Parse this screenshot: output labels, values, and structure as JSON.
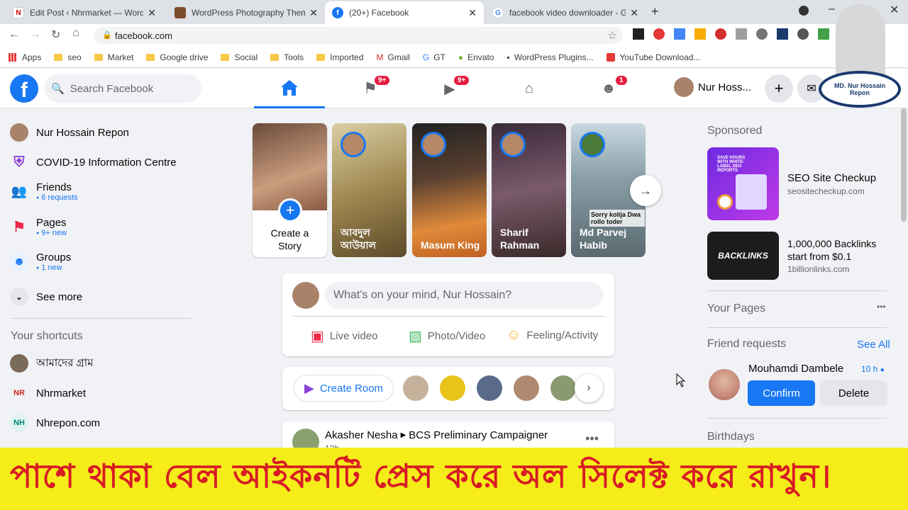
{
  "browser": {
    "tabs": [
      {
        "title": "Edit Post ‹ Nhrmarket — WordPr",
        "active": false
      },
      {
        "title": "WordPress Photography Themes",
        "active": false
      },
      {
        "title": "(20+) Facebook",
        "active": true
      },
      {
        "title": "facebook video downloader - Go",
        "active": false
      }
    ],
    "url": "facebook.com",
    "bookmarks": [
      "Apps",
      "seo",
      "Market",
      "Google drive",
      "Social",
      "Tools",
      "Imported",
      "Gmail",
      "GT",
      "Envato",
      "WordPress Plugins...",
      "YouTube Download..."
    ]
  },
  "fb": {
    "search_placeholder": "Search Facebook",
    "badges": {
      "pages": "9+",
      "watch": "9+",
      "groups": "1"
    },
    "profile_short": "Nur Hoss...",
    "overlay_text": "MD. Nur Hossain Repon"
  },
  "left": {
    "items": [
      {
        "label": "Nur Hossain Repon",
        "sub": ""
      },
      {
        "label": "COVID-19 Information Centre",
        "sub": ""
      },
      {
        "label": "Friends",
        "sub": "6 requests"
      },
      {
        "label": "Pages",
        "sub": "9+ new"
      },
      {
        "label": "Groups",
        "sub": "1 new"
      },
      {
        "label": "See more",
        "sub": ""
      }
    ],
    "shortcuts_title": "Your shortcuts",
    "shortcuts": [
      "আমাদের গ্রাম",
      "Nhrmarket",
      "Nhrepon.com"
    ]
  },
  "stories": [
    {
      "name": "Create a\nStory",
      "line1": "Create a",
      "line2": "Story"
    },
    {
      "line1": "আবদুল",
      "line2": "আউয়াল"
    },
    {
      "line1": "Masum King",
      "line2": ""
    },
    {
      "line1": "Sharif",
      "line2": "Rahman"
    },
    {
      "line1": "Md Parvej",
      "line2": "Habib"
    }
  ],
  "story_caption": "Sorry kolija  Dwa rollo toder",
  "composer": {
    "placeholder": "What's on your mind, Nur Hossain?",
    "live": "Live video",
    "photo": "Photo/Video",
    "feeling": "Feeling/Activity"
  },
  "rooms": {
    "create": "Create Room"
  },
  "post": {
    "author": "Akasher Nesha",
    "target": "BCS Preliminary Campaigner",
    "time": "13h"
  },
  "right": {
    "sponsored": "Sponsored",
    "ads": [
      {
        "title": "SEO Site Checkup",
        "url": "seositecheckup.com",
        "img_text": "SAVE HOURS WITH WHITE-LABEL SEO REPORTS"
      },
      {
        "title": "1,000,000 Backlinks start from $0.1",
        "url": "1billionlinks.com",
        "img_text": "BACKLINKS"
      }
    ],
    "your_pages": "Your Pages",
    "friend_requests": "Friend requests",
    "see_all": "See All",
    "requester": "Mouhamdi Dambele",
    "req_time": "10 h",
    "confirm": "Confirm",
    "delete": "Delete",
    "birthdays": "Birthdays"
  },
  "banner": "পাশে থাকা বেল আইকনটি প্রেস করে অল সিলেক্ট করে রাখুন।",
  "colors": {
    "fb_blue": "#1877f2",
    "banner_bg": "#f5ec1a",
    "banner_text": "#d81b25"
  }
}
